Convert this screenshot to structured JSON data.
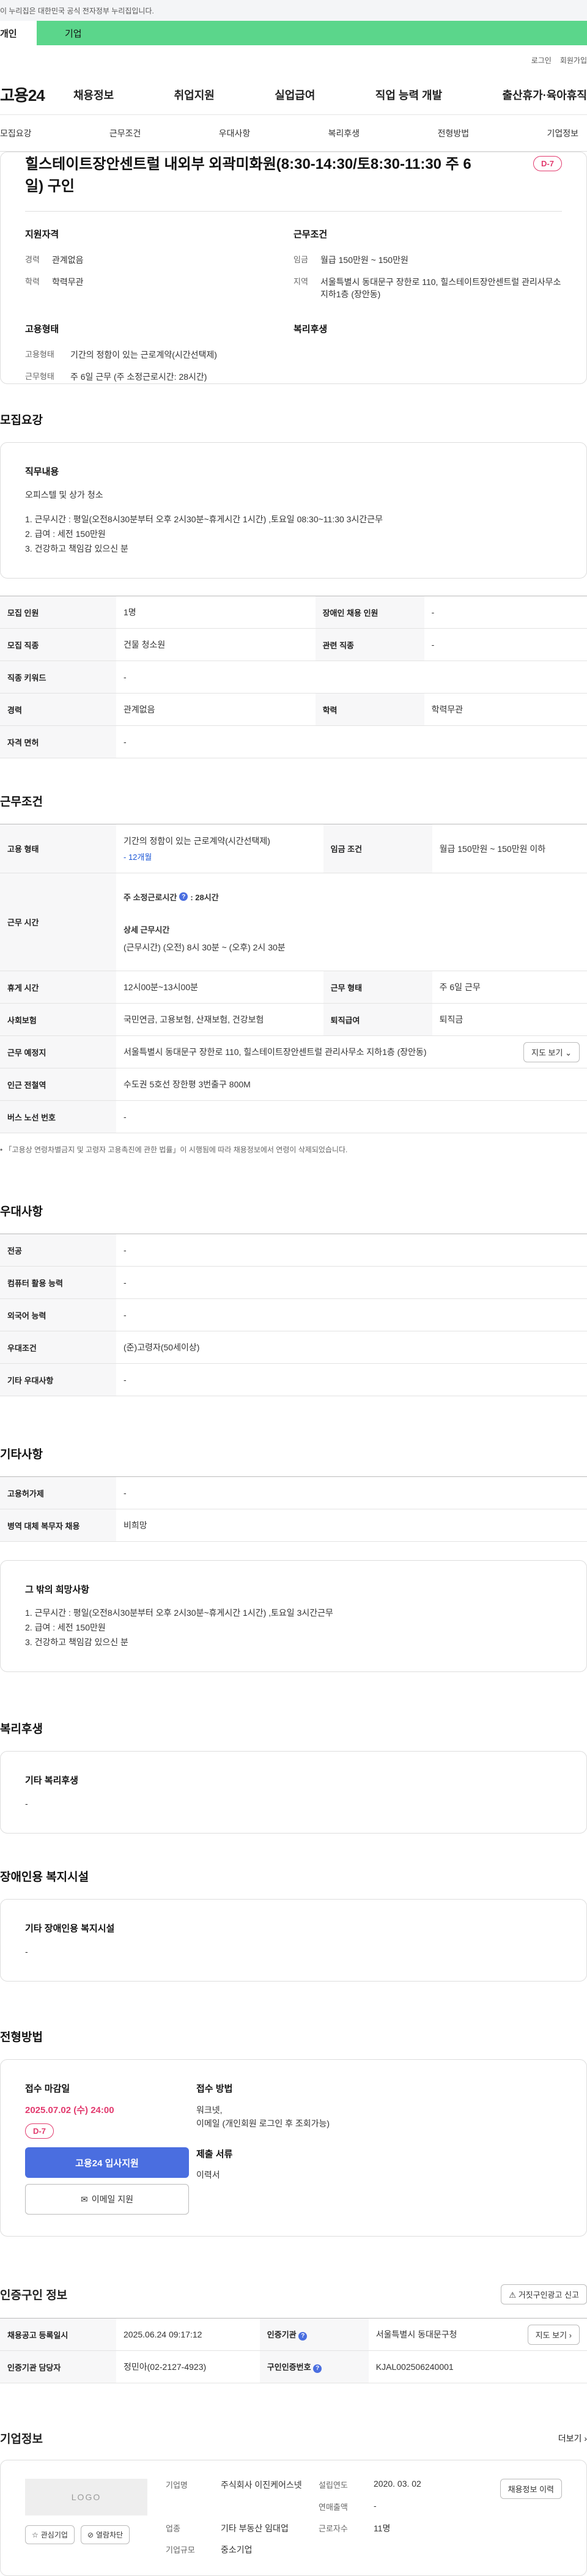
{
  "gov_banner": "이 누리집은 대한민국 공식 전자정부 누리집입니다.",
  "user_tabs": [
    "개인",
    "기업"
  ],
  "util_links": [
    "로그인",
    "회원가입"
  ],
  "logo": "고용24",
  "gnb": [
    "채용정보",
    "취업지원",
    "실업급여",
    "직업 능력 개발",
    "출산휴가·육아휴직"
  ],
  "subnav": [
    "모집요강",
    "근무조건",
    "우대사항",
    "복리후생",
    "전형방법",
    "기업정보"
  ],
  "job": {
    "title": "힐스테이트장안센트럴 내외부 외곽미화원(8:30-14:30/토8:30-11:30 주 6일) 구인",
    "dday": "D-7"
  },
  "summary": {
    "qual_title": "지원자격",
    "qual": [
      {
        "k": "경력",
        "v": "관계없음"
      },
      {
        "k": "학력",
        "v": "학력무관"
      }
    ],
    "cond_title": "근무조건",
    "cond": [
      {
        "k": "임금",
        "v": "월급 150만원 ~ 150만원"
      },
      {
        "k": "지역",
        "v": "서울특별시 동대문구 장한로 110, 힐스테이트장안센트럴 관리사무소 지하1층 (장안동)"
      }
    ],
    "emp_title": "고용형태",
    "emp": [
      {
        "k": "고용형태",
        "v": "기간의 정함이 있는 근로계약(시간선택제)"
      },
      {
        "k": "근무형태",
        "v": "주 6일 근무 (주 소정근로시간: 28시간)"
      }
    ],
    "welfare_title": "복리후생"
  },
  "recruit": {
    "section": "모집요강",
    "duty_title": "직무내용",
    "duty_lines": [
      "오피스텔 및 상가 청소",
      "",
      "1. 근무시간 : 평일(오전8시30분부터 오후 2시30분~휴게시간 1시간) ,토요일 08:30~11:30 3시간근무",
      "2. 급여 : 세전 150만원",
      "3. 건강하고 책임감 있으신 분"
    ],
    "rows": [
      {
        "k1": "모집 인원",
        "v1": "1명",
        "k2": "장애인 채용 인원",
        "v2": "-"
      },
      {
        "k1": "모집 직종",
        "v1": "건물 청소원",
        "k2": "관련 직종",
        "v2": "-"
      },
      {
        "k1": "직종 키워드",
        "v1": "-"
      },
      {
        "k1": "경력",
        "v1": "관계없음",
        "k2": "학력",
        "v2": "학력무관"
      },
      {
        "k1": "자격 면허",
        "v1": "-"
      }
    ]
  },
  "work": {
    "section": "근무조건",
    "emp_k": "고용 형태",
    "emp_v": "기간의 정함이 있는 근로계약(시간선택제)",
    "emp_link": "- 12개월",
    "wage_k": "임금 조건",
    "wage_v": "월급 150만원 ~ 150만원 이하",
    "time_k": "근무 시간",
    "time_week": "주 소정근로시간",
    "time_week_v": ": 28시간",
    "time_detail_title": "상세 근무시간",
    "time_detail": "(근무시간) (오전) 8시 30분 ~ (오후) 2시 30분",
    "rest_k": "휴게 시간",
    "rest_v": "12시00분~13시00분",
    "form_k": "근무 형태",
    "form_v": "주 6일 근무",
    "ins_k": "사회보험",
    "ins_v": "국민연금, 고용보험, 산재보험, 건강보험",
    "sev_k": "퇴직급여",
    "sev_v": "퇴직금",
    "place_k": "근무 예정지",
    "place_v": "서울특별시 동대문구 장한로 110, 힐스테이트장안센트럴 관리사무소 지하1층 (장안동)",
    "map_btn": "지도 보기",
    "subway_k": "인근 전철역",
    "subway_v": "수도권 5호선 장한평 3번출구 800M",
    "bus_k": "버스 노선 번호",
    "bus_v": "-",
    "note": "「고용상 연령차별금지 및 고령자 고용촉진에 관한 법률」이 시행됨에 따라 채용정보에서 연령이 삭제되었습니다."
  },
  "pref": {
    "section": "우대사항",
    "rows": [
      {
        "k": "전공",
        "v": "-"
      },
      {
        "k": "컴퓨터 활용 능력",
        "v": "-"
      },
      {
        "k": "외국어 능력",
        "v": "-"
      },
      {
        "k": "우대조건",
        "v": "(준)고령자(50세이상)"
      },
      {
        "k": "기타 우대사항",
        "v": "-"
      }
    ]
  },
  "etc": {
    "section": "기타사항",
    "rows": [
      {
        "k": "고용허가제",
        "v": "-"
      },
      {
        "k": "병역 대체 복무자 채용",
        "v": "비희망"
      }
    ],
    "other_title": "그 밖의 희망사항",
    "other_lines": [
      "1. 근무시간 : 평일(오전8시30분부터 오후 2시30분~휴게시간 1시간) ,토요일 3시간근무",
      "2. 급여 : 세전 150만원",
      "3. 건강하고 책임감 있으신 분"
    ]
  },
  "welfare": {
    "section": "복리후생",
    "title": "기타 복리후생",
    "value": "-"
  },
  "disabled": {
    "section": "장애인용 복지시설",
    "title": "기타 장애인용 복지시설",
    "value": "-"
  },
  "apply": {
    "section": "전형방법",
    "deadline_title": "접수 마감일",
    "deadline": "2025.07.02 (수) 24:00",
    "dday": "D-7",
    "apply_btn": "고용24 입사지원",
    "email_btn": "이메일 지원",
    "method_title": "접수 방법",
    "method_lines": [
      "워크넷,",
      "이메일 (개인회원 로그인 후 조회가능)"
    ],
    "docs_title": "제출 서류",
    "docs": "이력서"
  },
  "cert": {
    "section": "인증구인 정보",
    "report_btn": "거짓구인광고 신고",
    "rows": [
      {
        "k1": "채용공고 등록일시",
        "v1": "2025.06.24 09:17:12",
        "k2": "인증기관",
        "v2": "서울특별시 동대문구청",
        "btn": "지도 보기"
      },
      {
        "k1": "인증기관 담당자",
        "v1": "정민아(02-2127-4923)",
        "k2": "구인인증번호",
        "v2": "KJAL002506240001"
      }
    ]
  },
  "company": {
    "section": "기업정보",
    "more": "더보기",
    "logo": "LOGO",
    "fav_btn": "관심기업",
    "block_btn": "열람차단",
    "name_k": "기업명",
    "name_v": "주식회사 이진케어스넷",
    "est_k": "설립연도",
    "est_v": "2020. 03. 02",
    "sales_k": "연매출액",
    "sales_v": "-",
    "ind_k": "업종",
    "ind_v": "기타 부동산 임대업",
    "emp_k": "근로자수",
    "emp_v": "11명",
    "size_k": "기업규모",
    "size_v": "중소기업",
    "jobs_btn": "채용정보 이력"
  }
}
